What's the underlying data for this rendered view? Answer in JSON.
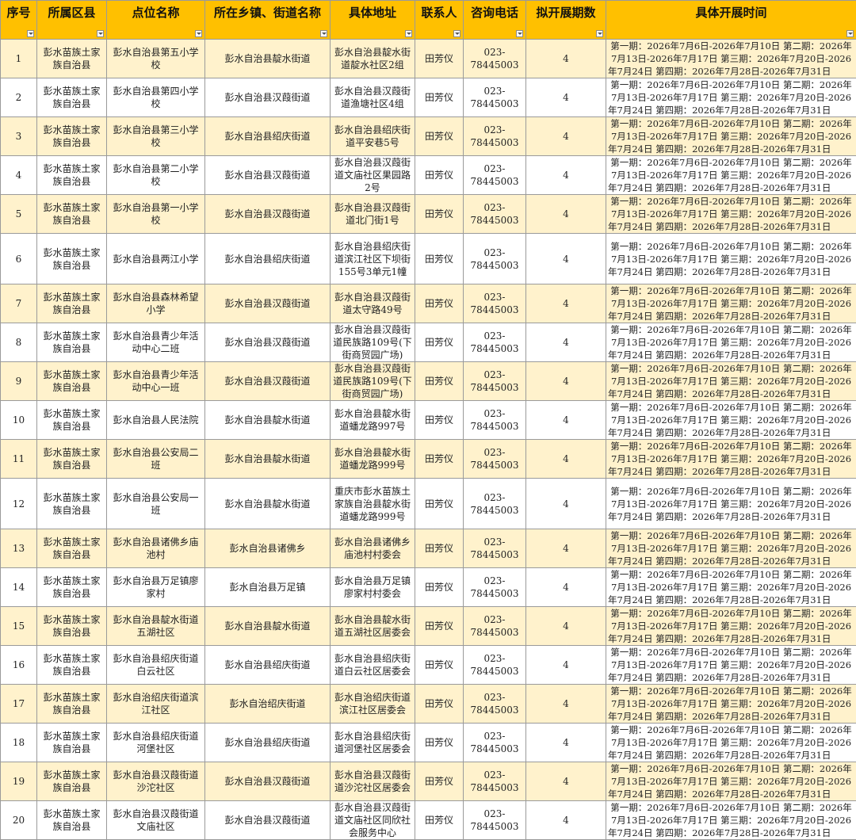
{
  "columns": [
    "序号",
    "所属区县",
    "点位名称",
    "所在乡镇、街道名称",
    "具体地址",
    "联系人",
    "咨询电话",
    "拟开展期数",
    "具体开展时间"
  ],
  "schedule_text": "第一期：2026年7月6日-2026年7月10日 第二期：2026年7月13日-2026年7月17日 第三期：2026年7月20日-2026年7月24日 第四期：2026年7月28日-2026年7月31日",
  "rows": [
    {
      "seq": "1",
      "county": "彭水苗族土家族自治县",
      "site": "彭水自治县第五小学校",
      "street": "彭水自治县靛水街道",
      "address": "彭水自治县靛水街道靛水社区2组",
      "contact": "田芳仪",
      "phone": "023-78445003",
      "periods": "4"
    },
    {
      "seq": "2",
      "county": "彭水苗族土家族自治县",
      "site": "彭水自治县第四小学校",
      "street": "彭水自治县汉葭街道",
      "address": "彭水自治县汉葭街道渔塘社区4组",
      "contact": "田芳仪",
      "phone": "023-78445003",
      "periods": "4"
    },
    {
      "seq": "3",
      "county": "彭水苗族土家族自治县",
      "site": "彭水自治县第三小学校",
      "street": "彭水自治县绍庆街道",
      "address": "彭水自治县绍庆街道平安巷5号",
      "contact": "田芳仪",
      "phone": "023-78445003",
      "periods": "4"
    },
    {
      "seq": "4",
      "county": "彭水苗族土家族自治县",
      "site": "彭水自治县第二小学校",
      "street": "彭水自治县汉葭街道",
      "address": "彭水自治县汉葭街道文庙社区果园路2号",
      "contact": "田芳仪",
      "phone": "023-78445003",
      "periods": "4"
    },
    {
      "seq": "5",
      "county": "彭水苗族土家族自治县",
      "site": "彭水自治县第一小学校",
      "street": "彭水自治县汉葭街道",
      "address": "彭水自治县汉葭街道北门街1号",
      "contact": "田芳仪",
      "phone": "023-78445003",
      "periods": "4"
    },
    {
      "seq": "6",
      "county": "彭水苗族土家族自治县",
      "site": "彭水自治县两江小学",
      "street": "彭水自治县绍庆街道",
      "address": "彭水自治县绍庆街道滨江社区下坝街155号3单元1幢",
      "contact": "田芳仪",
      "phone": "023-78445003",
      "periods": "4"
    },
    {
      "seq": "7",
      "county": "彭水苗族土家族自治县",
      "site": "彭水自治县森林希望小学",
      "street": "彭水自治县汉葭街道",
      "address": "彭水自治县汉葭街道太守路49号",
      "contact": "田芳仪",
      "phone": "023-78445003",
      "periods": "4"
    },
    {
      "seq": "8",
      "county": "彭水苗族土家族自治县",
      "site": "彭水自治县青少年活动中心二班",
      "street": "彭水自治县汉葭街道",
      "address": "彭水自治县汉葭街道民族路109号(下街商贸园广场)",
      "contact": "田芳仪",
      "phone": "023-78445003",
      "periods": "4"
    },
    {
      "seq": "9",
      "county": "彭水苗族土家族自治县",
      "site": "彭水自治县青少年活动中心一班",
      "street": "彭水自治县汉葭街道",
      "address": "彭水自治县汉葭街道民族路109号(下街商贸园广场)",
      "contact": "田芳仪",
      "phone": "023-78445003",
      "periods": "4"
    },
    {
      "seq": "10",
      "county": "彭水苗族土家族自治县",
      "site": "彭水自治县人民法院",
      "street": "彭水自治县靛水街道",
      "address": "彭水自治县靛水街道蟠龙路997号",
      "contact": "田芳仪",
      "phone": "023-78445003",
      "periods": "4"
    },
    {
      "seq": "11",
      "county": "彭水苗族土家族自治县",
      "site": "彭水自治县公安局二班",
      "street": "彭水自治县靛水街道",
      "address": "彭水自治县靛水街道蟠龙路999号",
      "contact": "田芳仪",
      "phone": "023-78445003",
      "periods": "4"
    },
    {
      "seq": "12",
      "county": "彭水苗族土家族自治县",
      "site": "彭水自治县公安局一班",
      "street": "彭水自治县靛水街道",
      "address": "重庆市彭水苗族土家族自治县靛水街道蟠龙路999号",
      "contact": "田芳仪",
      "phone": "023-78445003",
      "periods": "4"
    },
    {
      "seq": "13",
      "county": "彭水苗族土家族自治县",
      "site": "彭水自治县诸佛乡庙池村",
      "street": "彭水自治县诸佛乡",
      "address": "彭水自治县诸佛乡庙池村村委会",
      "contact": "田芳仪",
      "phone": "023-78445003",
      "periods": "4"
    },
    {
      "seq": "14",
      "county": "彭水苗族土家族自治县",
      "site": "彭水自治县万足镇廖家村",
      "street": "彭水自治县万足镇",
      "address": "彭水自治县万足镇廖家村村委会",
      "contact": "田芳仪",
      "phone": "023-78445003",
      "periods": "4"
    },
    {
      "seq": "15",
      "county": "彭水苗族土家族自治县",
      "site": "彭水自治县靛水街道五湖社区",
      "street": "彭水自治县靛水街道",
      "address": "彭水自治县靛水街道五湖社区居委会",
      "contact": "田芳仪",
      "phone": "023-78445003",
      "periods": "4"
    },
    {
      "seq": "16",
      "county": "彭水苗族土家族自治县",
      "site": "彭水自治县绍庆街道白云社区",
      "street": "彭水自治县绍庆街道",
      "address": "彭水自治县绍庆街道白云社区居委会",
      "contact": "田芳仪",
      "phone": "023-78445003",
      "periods": "4"
    },
    {
      "seq": "17",
      "county": "彭水苗族土家族自治县",
      "site": "彭水自治绍庆街道滨江社区",
      "street": "彭水自治绍庆街道",
      "address": "彭水自治绍庆街道滨江社区居委会",
      "contact": "田芳仪",
      "phone": "023-78445003",
      "periods": "4"
    },
    {
      "seq": "18",
      "county": "彭水苗族土家族自治县",
      "site": "彭水自治县绍庆街道河堡社区",
      "street": "彭水自治县绍庆街道",
      "address": "彭水自治县绍庆街道河堡社区居委会",
      "contact": "田芳仪",
      "phone": "023-78445003",
      "periods": "4"
    },
    {
      "seq": "19",
      "county": "彭水苗族土家族自治县",
      "site": "彭水自治县汉葭街道沙沱社区",
      "street": "彭水自治县汉葭街道",
      "address": "彭水自治县汉葭街道沙沱社区居委会",
      "contact": "田芳仪",
      "phone": "023-78445003",
      "periods": "4"
    },
    {
      "seq": "20",
      "county": "彭水苗族土家族自治县",
      "site": "彭水自治县汉葭街道文庙社区",
      "street": "彭水自治县汉葭街道",
      "address": "彭水自治县汉葭街道文庙社区同欣社会服务中心",
      "contact": "田芳仪",
      "phone": "023-78445003",
      "periods": "4"
    }
  ]
}
